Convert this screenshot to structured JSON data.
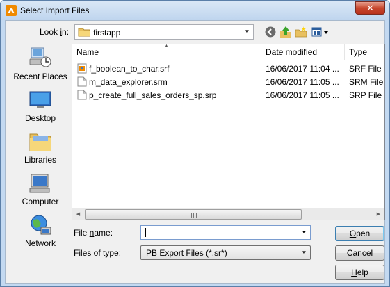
{
  "window": {
    "title": "Select Import Files",
    "close_symbol": "✕"
  },
  "lookin": {
    "label_pre": "Look ",
    "label_accel": "i",
    "label_post": "n:",
    "value": "firstapp",
    "arrow": "▼",
    "tools": [
      "back-icon",
      "up-folder-icon",
      "new-folder-icon",
      "view-menu-icon"
    ]
  },
  "places": [
    {
      "label": "Recent Places",
      "icon": "recent-places-icon"
    },
    {
      "label": "Desktop",
      "icon": "desktop-icon"
    },
    {
      "label": "Libraries",
      "icon": "libraries-icon"
    },
    {
      "label": "Computer",
      "icon": "computer-icon"
    },
    {
      "label": "Network",
      "icon": "network-icon"
    }
  ],
  "filelist": {
    "columns": [
      "Name",
      "Date modified",
      "Type"
    ],
    "sort_arrow": "▲",
    "files": [
      {
        "name": "f_boolean_to_char.srf",
        "date": "16/06/2017 11:04 ...",
        "type": "SRF File",
        "icon": "srf-file-icon"
      },
      {
        "name": "m_data_explorer.srm",
        "date": "16/06/2017 11:05 ...",
        "type": "SRM File",
        "icon": "srm-file-icon"
      },
      {
        "name": "p_create_full_sales_orders_sp.srp",
        "date": "16/06/2017 11:05 ...",
        "type": "SRP File",
        "icon": "srp-file-icon"
      }
    ],
    "scroll_left": "◀",
    "scroll_right": "▶"
  },
  "filename": {
    "label_pre": "File ",
    "label_accel": "n",
    "label_post": "ame:",
    "value": "",
    "arrow": "▼"
  },
  "filetype": {
    "label": "Files of type:",
    "value": "PB Export Files (*.sr*)",
    "arrow": "▼"
  },
  "buttons": {
    "open_accel": "O",
    "open_rest": "pen",
    "cancel": "Cancel",
    "help_accel": "H",
    "help_rest": "elp"
  }
}
